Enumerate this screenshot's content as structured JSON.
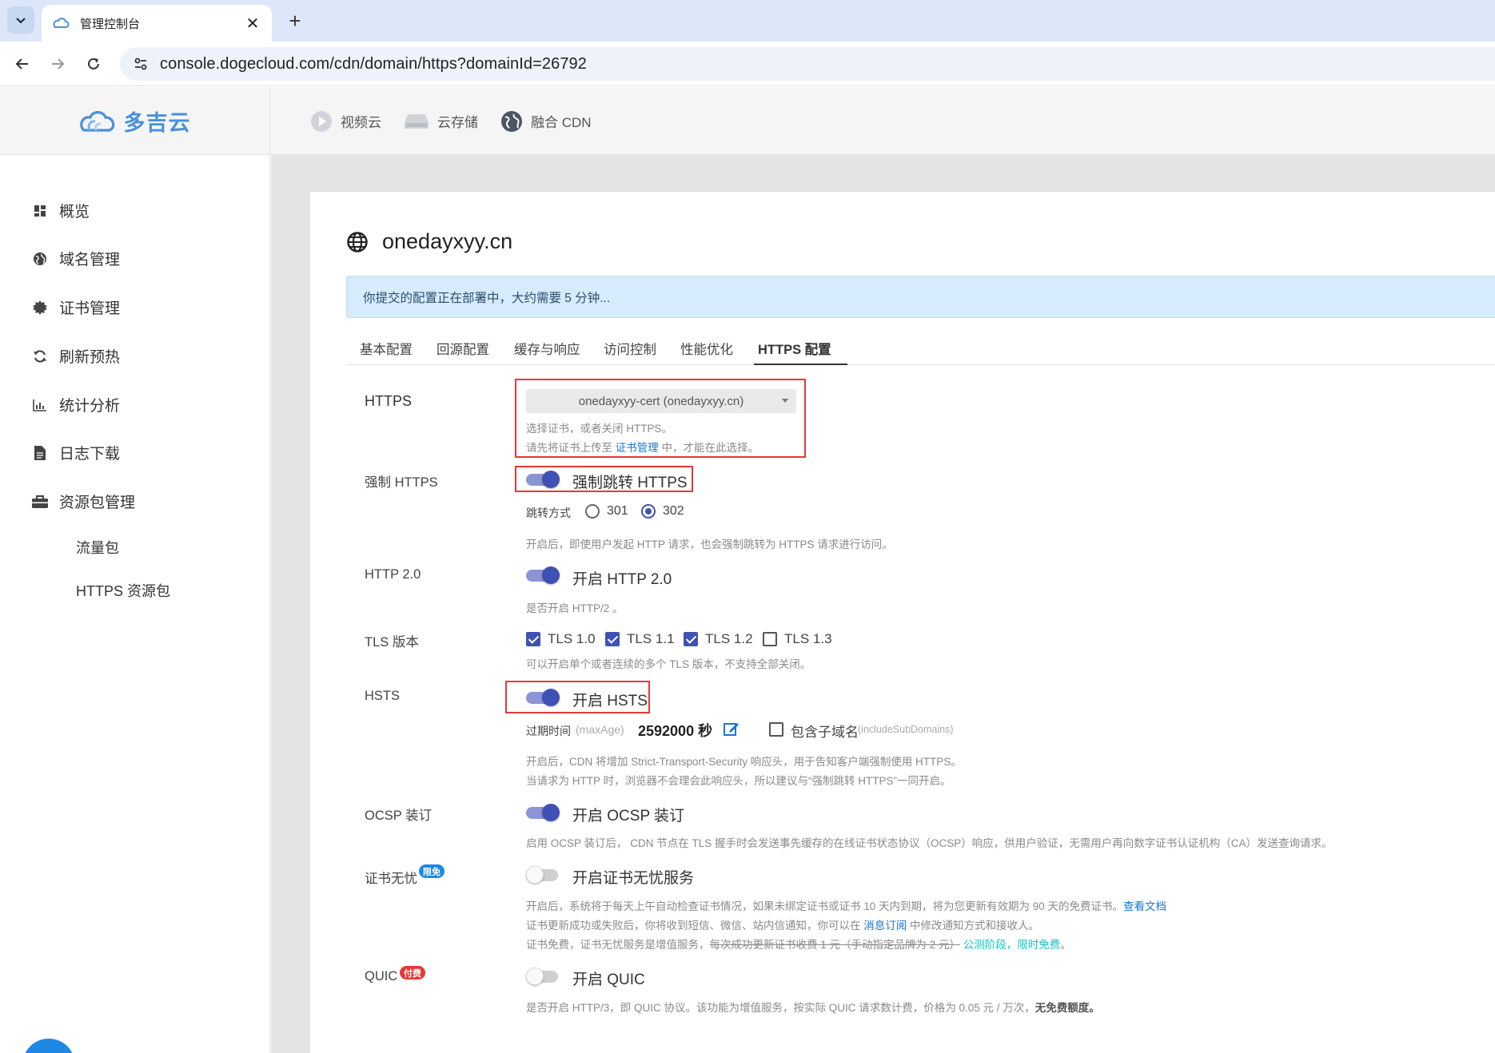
{
  "browser": {
    "tab_title": "管理控制台",
    "url": "console.dogecloud.com/cdn/domain/https?domainId=26792"
  },
  "header": {
    "logo_text": "多吉云",
    "nav": [
      {
        "label": "视频云",
        "icon": "play-circle-icon"
      },
      {
        "label": "云存储",
        "icon": "storage-icon"
      },
      {
        "label": "融合 CDN",
        "icon": "globe-icon"
      }
    ]
  },
  "sidebar": {
    "items": [
      {
        "label": "概览",
        "icon": "dashboard-icon"
      },
      {
        "label": "域名管理",
        "icon": "globe-icon"
      },
      {
        "label": "证书管理",
        "icon": "certificate-icon"
      },
      {
        "label": "刷新预热",
        "icon": "refresh-icon"
      },
      {
        "label": "统计分析",
        "icon": "chart-icon"
      },
      {
        "label": "日志下载",
        "icon": "document-icon"
      },
      {
        "label": "资源包管理",
        "icon": "briefcase-icon"
      }
    ],
    "subitems": [
      {
        "label": "流量包"
      },
      {
        "label": "HTTPS 资源包"
      }
    ]
  },
  "page": {
    "title": "onedayxyy.cn",
    "alert": "你提交的配置正在部署中，大约需要 5 分钟...",
    "tabs": [
      {
        "label": "基本配置"
      },
      {
        "label": "回源配置"
      },
      {
        "label": "缓存与响应"
      },
      {
        "label": "访问控制"
      },
      {
        "label": "性能优化"
      },
      {
        "label": "HTTPS 配置",
        "active": true
      }
    ]
  },
  "https": {
    "label": "HTTPS",
    "cert_selected": "onedayxyy-cert (onedayxyy.cn)",
    "hint1": "选择证书，或者关闭 HTTPS。",
    "hint2_pre": "请先将证书上传至",
    "hint2_link": "证书管理",
    "hint2_post": "中，才能在此选择。"
  },
  "force_https": {
    "label": "强制 HTTPS",
    "toggle_label": "强制跳转 HTTPS",
    "enabled": true,
    "redirect_label": "跳转方式",
    "options": [
      "301",
      "302"
    ],
    "selected": "302",
    "hint": "开启后，即使用户发起 HTTP 请求，也会强制跳转为 HTTPS 请求进行访问。"
  },
  "http2": {
    "label": "HTTP 2.0",
    "toggle_label": "开启 HTTP 2.0",
    "enabled": true,
    "hint": "是否开启 HTTP/2 。"
  },
  "tls": {
    "label": "TLS 版本",
    "versions": [
      {
        "label": "TLS 1.0",
        "checked": true
      },
      {
        "label": "TLS 1.1",
        "checked": true
      },
      {
        "label": "TLS 1.2",
        "checked": true
      },
      {
        "label": "TLS 1.3",
        "checked": false
      }
    ],
    "hint": "可以开启单个或者连续的多个 TLS 版本，不支持全部关闭。"
  },
  "hsts": {
    "label": "HSTS",
    "toggle_label": "开启 HSTS",
    "enabled": true,
    "maxage_label": "过期时间",
    "maxage_key": "(maxAge)",
    "maxage_value": "2592000 秒",
    "subdomains_label": "包含子域名",
    "subdomains_key": "(includeSubDomains)",
    "subdomains_checked": false,
    "hint1": "开启后，CDN 将增加 Strict-Transport-Security 响应头，用于告知客户端强制使用 HTTPS。",
    "hint2": "当请求为 HTTP 时，浏览器不会理会此响应头，所以建议与“强制跳转 HTTPS”一同开启。"
  },
  "ocsp": {
    "label": "OCSP 装订",
    "toggle_label": "开启 OCSP 装订",
    "enabled": true,
    "hint": "启用 OCSP 装订后， CDN 节点在 TLS 握手时会发送事先缓存的在线证书状态协议（OCSP）响应，供用户验证，无需用户再向数字证书认证机构（CA）发送查询请求。"
  },
  "cert_care": {
    "label": "证书无忧",
    "badge": "限免",
    "badge_color": "#1e88e5",
    "toggle_label": "开启证书无忧服务",
    "enabled": false,
    "hint1_pre": "开启后，系统将于每天上午自动检查证书情况，如果未绑定证书或证书 10 天内到期，将为您更新有效期为 90 天的免费证书。",
    "hint1_link": "查看文档",
    "hint2_pre": "证书更新成功或失败后，你将收到短信、微信、站内信通知，你可以在",
    "hint2_link": "消息订阅",
    "hint2_post": "中修改通知方式和接收人。",
    "hint3_pre": "证书免费，证书无忧服务是增值服务，",
    "hint3_strike": "每次成功更新证书收费 1 元（手动指定品牌为 2 元）",
    "hint3_cyan1": "公测阶段",
    "hint3_sep": "，",
    "hint3_cyan2": "限时免费",
    "hint3_end": "。"
  },
  "quic": {
    "label": "QUIC",
    "badge": "付费",
    "badge_color": "#e53935",
    "toggle_label": "开启 QUIC",
    "enabled": false,
    "hint_pre": "是否开启 HTTP/3，即 QUIC 协议。该功能为增值服务，按实际 QUIC 请求数计费，价格为 0.05 元 / 万次，",
    "hint_bold": "无免费额度。"
  },
  "colors": {
    "accent": "#3f51b5",
    "highlight_border": "#e53935",
    "alert_bg": "#d6ebfb",
    "link": "#1976d2"
  }
}
